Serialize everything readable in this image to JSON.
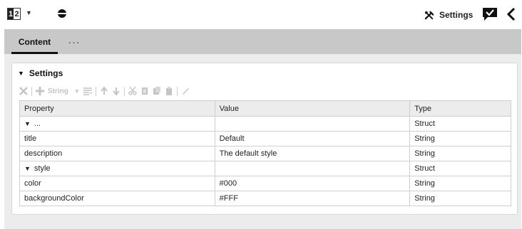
{
  "topbar": {
    "number_selector": {
      "digit_active": "1",
      "digit_other": "2",
      "caret_icon": "caret-down-icon"
    },
    "globe_icon": "globe-icon",
    "settings": {
      "label": "Settings",
      "icon": "tools-icon"
    },
    "chat_check_icon": "chat-check-icon",
    "back_icon": "chevron-left-icon"
  },
  "tabs": [
    {
      "label": "Content",
      "active": true
    },
    {
      "label": "···",
      "active": false
    }
  ],
  "panel": {
    "title": "Settings",
    "toolbar": {
      "type_dropdown_label": "String"
    },
    "columns": [
      "Property",
      "Value",
      "Type"
    ],
    "rows": [
      {
        "property": "...",
        "value": "",
        "type": "Struct",
        "expanded": true,
        "depth": 0
      },
      {
        "property": "title",
        "value": "Default",
        "type": "String",
        "depth": 1
      },
      {
        "property": "description",
        "value": "The default style",
        "type": "String",
        "depth": 1
      },
      {
        "property": "style",
        "value": "",
        "type": "Struct",
        "expanded": true,
        "depth": 1
      },
      {
        "property": "color",
        "value": "#000",
        "type": "String",
        "depth": 2
      },
      {
        "property": "backgroundColor",
        "value": "#FFF",
        "type": "String",
        "depth": 2
      }
    ]
  },
  "colors": {
    "tabbar_bg": "#c8c8c8",
    "content_bg": "#ececec",
    "toolbar_disabled": "#c4c4c4"
  }
}
